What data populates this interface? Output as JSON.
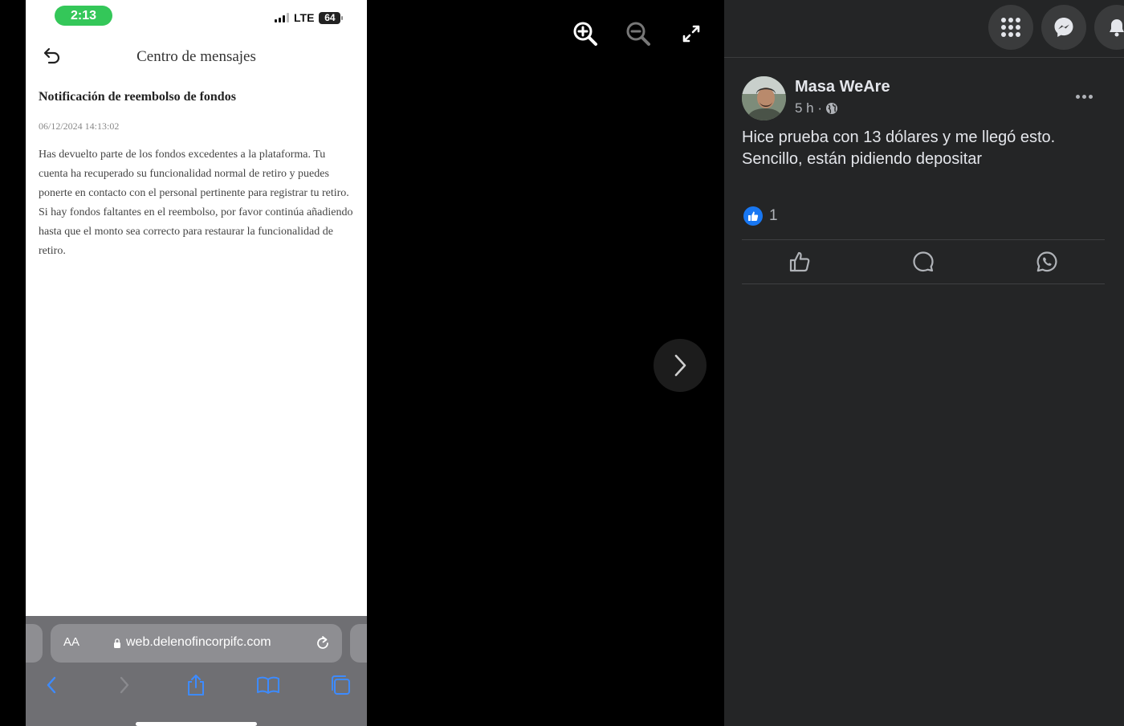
{
  "phone": {
    "status": {
      "time": "2:13",
      "network": "LTE",
      "battery": "64"
    },
    "header": {
      "title": "Centro de mensajes"
    },
    "message": {
      "title": "Notificación de reembolso de fondos",
      "date": "06/12/2024 14:13:02",
      "body": "Has devuelto parte de los fondos excedentes a la plataforma. Tu cuenta ha recuperado su funcionalidad normal de retiro y puedes ponerte en contacto con el personal pertinente para registrar tu retiro. Si hay fondos faltantes en el reembolso, por favor continúa añadiendo hasta que el monto sea correcto para restaurar la funcionalidad de retiro."
    },
    "browser": {
      "aa_label": "AA",
      "url": "web.delenofincorpifc.com"
    }
  },
  "post": {
    "author": "Masa WeAre",
    "time": "5 h ·",
    "text": "Hice prueba con 13 dólares y me llegó esto. Sencillo, están pidiendo depositar",
    "like_count": "1"
  },
  "colors": {
    "accent": "#1877f2",
    "panel": "#242526",
    "status_green": "#34c759"
  }
}
